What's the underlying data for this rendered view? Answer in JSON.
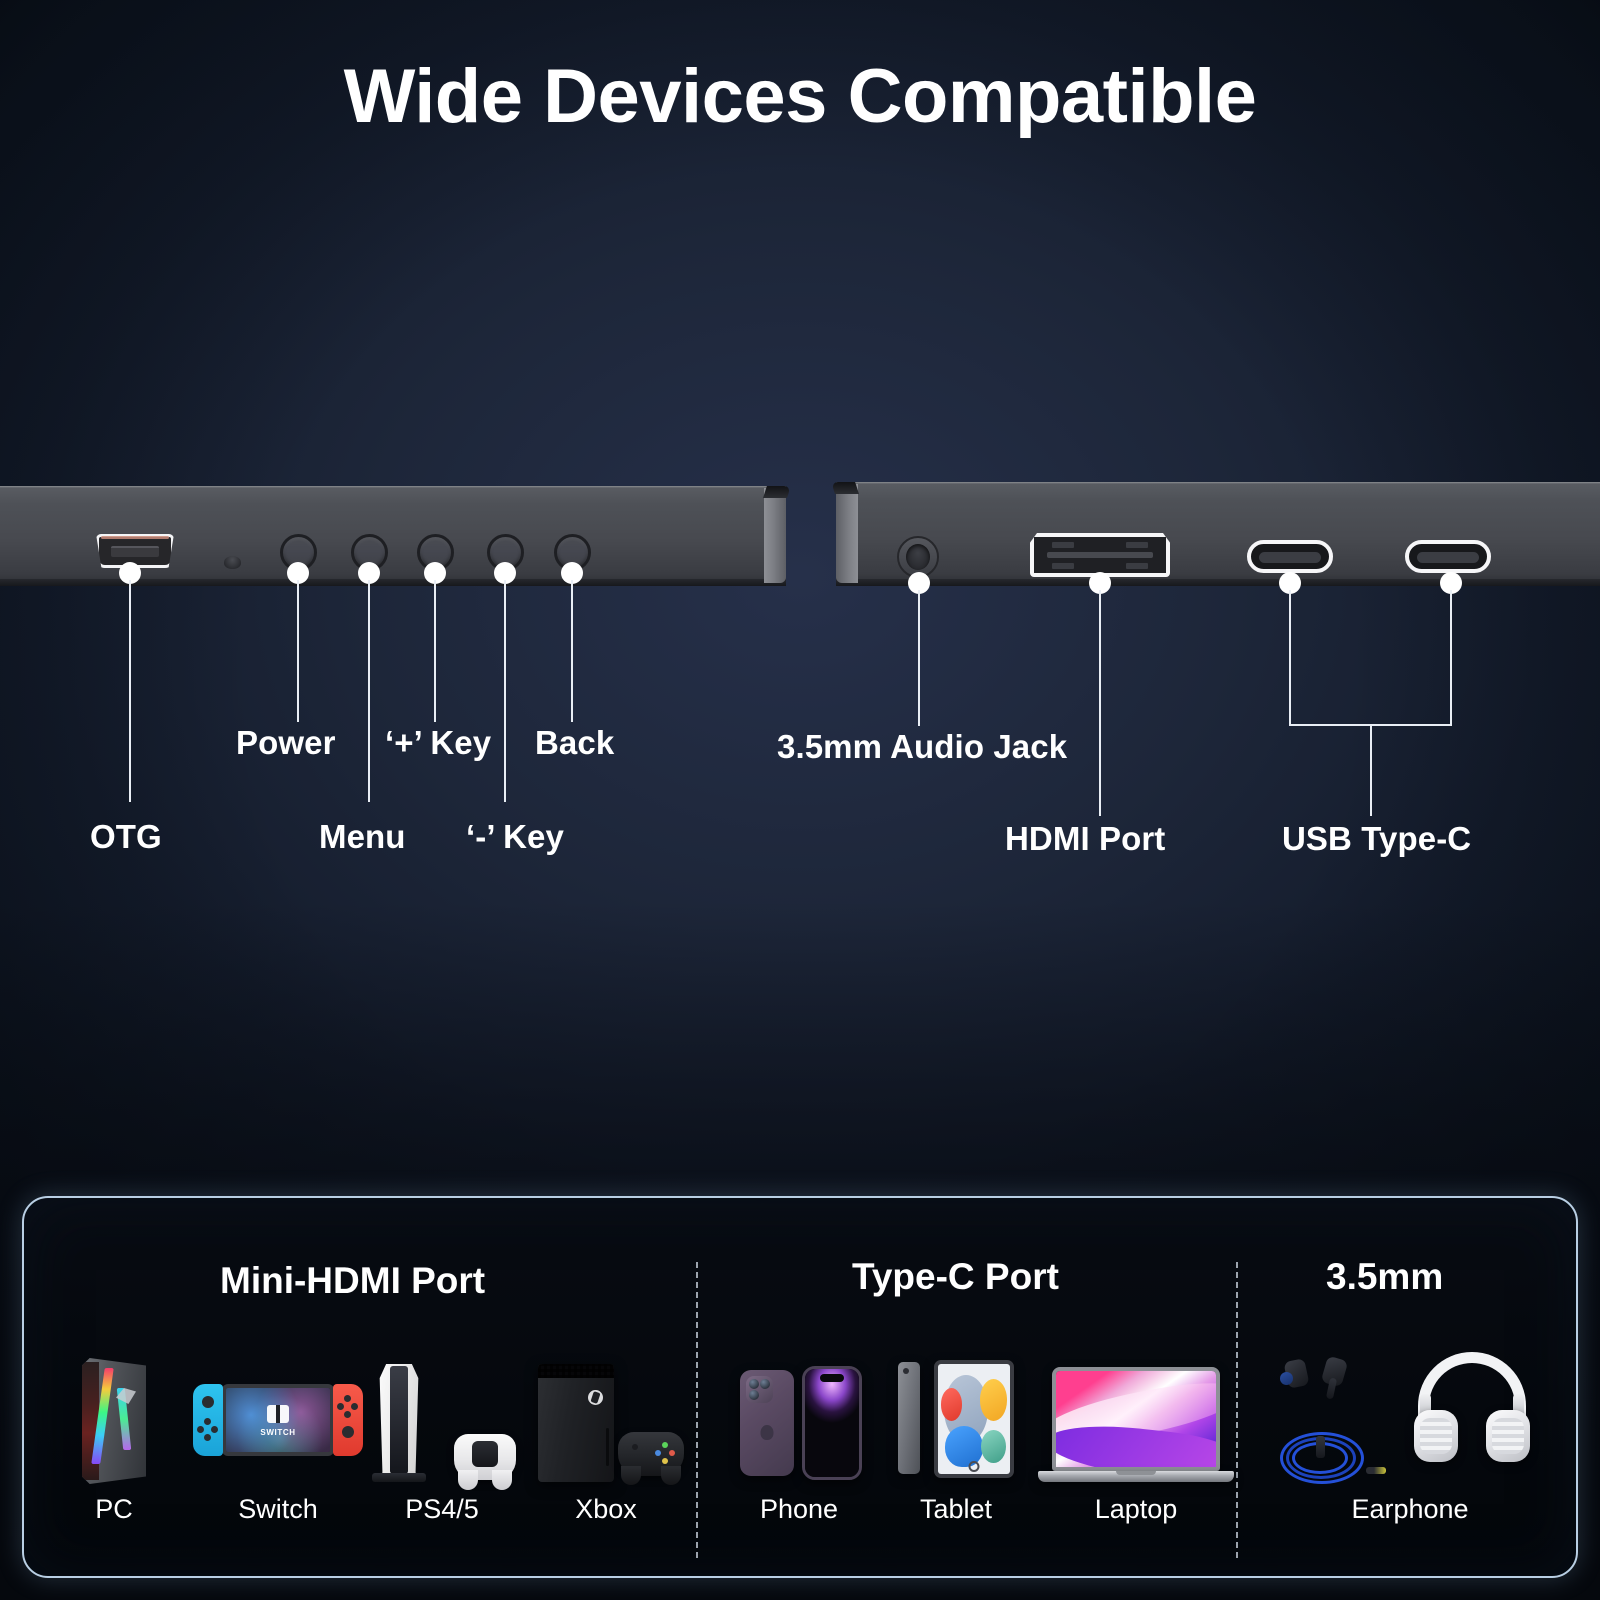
{
  "title": "Wide Devices Compatible",
  "colors": {
    "background_dark": "#0d1521",
    "background_mid": "#26304a",
    "text": "#ffffff",
    "panel_border": "#b9cfe4",
    "panel_bg": "#05080d",
    "callout_line": "#e9eef5"
  },
  "left_panel": {
    "ports": [
      {
        "name": "otg-port",
        "icon": "micro-usb-icon"
      },
      {
        "name": "led-indicator",
        "icon": "led-icon"
      },
      {
        "name": "menu-button",
        "icon": "circle-button-icon"
      },
      {
        "name": "minus-key-button",
        "icon": "circle-button-icon"
      },
      {
        "name": "plus-key-button",
        "icon": "circle-button-icon"
      },
      {
        "name": "power-button",
        "icon": "circle-button-icon"
      },
      {
        "name": "back-button",
        "icon": "circle-button-icon"
      }
    ],
    "callouts": [
      {
        "label": "OTG"
      },
      {
        "label": "Power"
      },
      {
        "label": "Menu"
      },
      {
        "label": "‘+’ Key"
      },
      {
        "label": "‘-’ Key"
      },
      {
        "label": "Back"
      }
    ]
  },
  "right_panel": {
    "ports": [
      {
        "name": "audio-jack-port",
        "icon": "audio-jack-icon"
      },
      {
        "name": "hdmi-port",
        "icon": "hdmi-icon"
      },
      {
        "name": "usb-c-port-1",
        "icon": "usb-c-icon"
      },
      {
        "name": "usb-c-port-2",
        "icon": "usb-c-icon"
      }
    ],
    "callouts": [
      {
        "label": "3.5mm Audio Jack"
      },
      {
        "label": "HDMI Port"
      },
      {
        "label": "USB Type-C"
      }
    ]
  },
  "compatibility_panel": {
    "sections": [
      {
        "heading": "Mini-HDMI Port",
        "devices": [
          {
            "label": "PC",
            "icon": "desktop-tower-icon"
          },
          {
            "label": "Switch",
            "icon": "nintendo-switch-icon"
          },
          {
            "label": "PS4/5",
            "icon": "playstation-console-icon"
          },
          {
            "label": "Xbox",
            "icon": "xbox-console-icon"
          }
        ]
      },
      {
        "heading": "Type-C  Port",
        "devices": [
          {
            "label": "Phone",
            "icon": "smartphone-icon"
          },
          {
            "label": "Tablet",
            "icon": "tablet-icon"
          },
          {
            "label": "Laptop",
            "icon": "laptop-icon"
          }
        ]
      },
      {
        "heading": "3.5mm",
        "devices": [
          {
            "label": "Earphone",
            "icon": "earphone-icon"
          }
        ]
      }
    ]
  }
}
